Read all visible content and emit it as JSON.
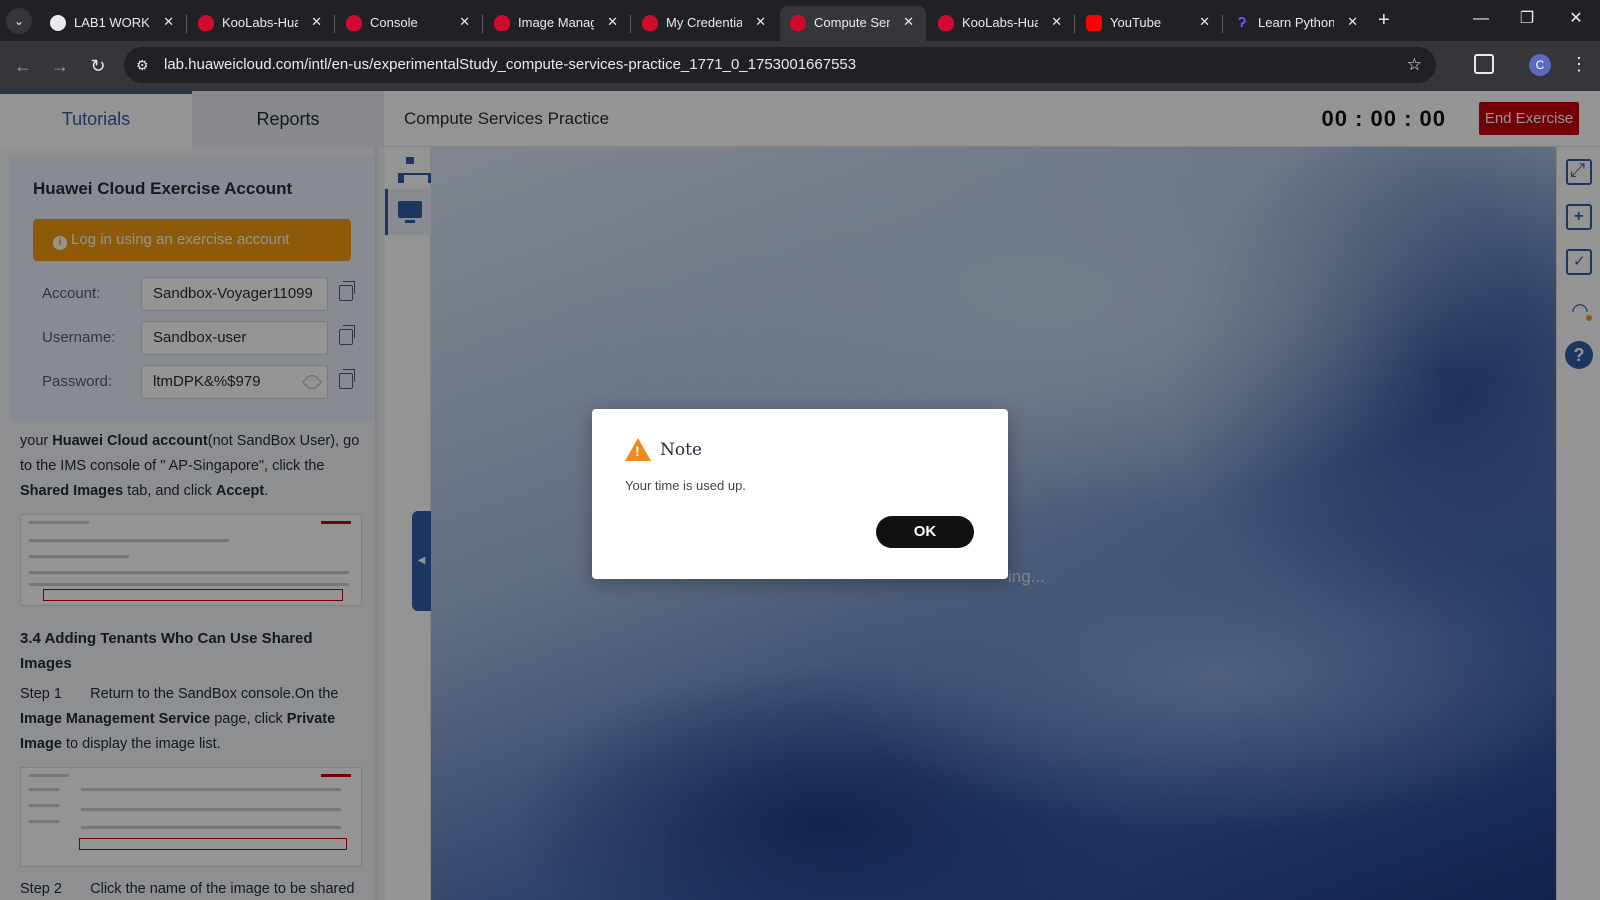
{
  "browser": {
    "tabs": [
      {
        "title": "LAB1 WORKF",
        "icon": "globe-icon"
      },
      {
        "title": "KooLabs-Hua",
        "icon": "huawei-icon"
      },
      {
        "title": "Console",
        "icon": "huawei-icon"
      },
      {
        "title": "Image Manag",
        "icon": "huawei-icon"
      },
      {
        "title": "My Credentia",
        "icon": "huawei-icon"
      },
      {
        "title": "Compute Ser",
        "icon": "huawei-icon",
        "active": true
      },
      {
        "title": "KooLabs-Hua",
        "icon": "huawei-icon"
      },
      {
        "title": "YouTube",
        "icon": "youtube-icon"
      },
      {
        "title": "Learn Python",
        "icon": "python-icon"
      }
    ],
    "url": "lab.huaweicloud.com/intl/en-us/experimentalStudy_compute-services-practice_1771_0_1753001667553",
    "profile_initial": "C"
  },
  "header": {
    "tabs": {
      "tutorials": "Tutorials",
      "reports": "Reports"
    },
    "title": "Compute Services Practice",
    "timer": "00 : 00 : 00",
    "end_button": "End Exercise"
  },
  "account": {
    "title": "Huawei Cloud Exercise Account",
    "login_button": "Log in using an exercise account",
    "fields": [
      {
        "label": "Account:",
        "value": "Sandbox-Voyager11099"
      },
      {
        "label": "Username:",
        "value": "Sandbox-user"
      },
      {
        "label": "Password:",
        "value": "ltmDPK&%$979"
      }
    ]
  },
  "doc": {
    "p1": {
      "t1": "your ",
      "b1": "Huawei Cloud account",
      "t2": "(not SandBox User), go to the IMS console of \" AP-Singapore\", click the ",
      "b2": "Shared Images",
      "t3": " tab, and click ",
      "b3": "Accept",
      "t4": "."
    },
    "heading": "3.4 Adding Tenants Who Can Use Shared Images",
    "step1": {
      "label": "Step 1",
      "t1": "Return to the SandBox console.On the ",
      "b1": "Image Management Service",
      "t2": " page, click ",
      "b2": "Private Image",
      "t3": " to display the image list."
    },
    "step2": {
      "label": "Step 2",
      "t1": "Click the name of the image to be shared"
    }
  },
  "desktop": {
    "loading_text": "ing..."
  },
  "dialog": {
    "title": "Note",
    "message": "Your time is used up.",
    "ok": "OK"
  },
  "colors": {
    "brand": "#2e5ea8",
    "end_button": "#c7000b",
    "login_button": "#f39c12",
    "warning": "#f08a1d"
  }
}
